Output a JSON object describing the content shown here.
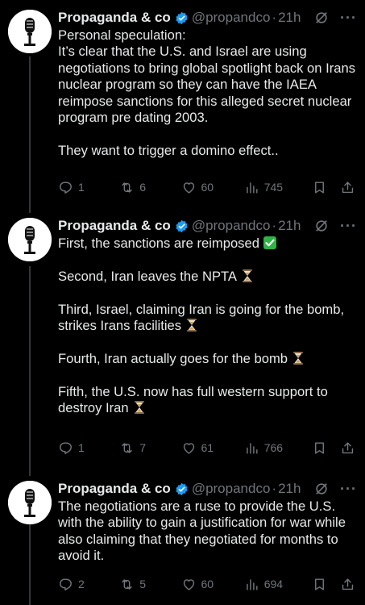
{
  "colors": {
    "background": "#000000",
    "text": "#e7e9ea",
    "muted": "#71767b",
    "verified": "#1d9bf0",
    "thread_line": "#333639"
  },
  "tweets": [
    {
      "author": {
        "name": "Propaganda & co",
        "handle": "@propandco",
        "verified": true,
        "avatar": "microphone-logo"
      },
      "separator": "·",
      "time": "21h",
      "lines": [
        "Personal speculation:",
        "It’s clear that the U.S. and Israel are using negotiations to bring global spotlight back on Irans nuclear program so they can have the IAEA reimpose sanctions for this alleged secret nuclear program pre dating 2003.",
        "They want to trigger a domino effect.."
      ],
      "stats": {
        "replies": "1",
        "reposts": "6",
        "likes": "60",
        "views": "745"
      }
    },
    {
      "author": {
        "name": "Propaganda & co",
        "handle": "@propandco",
        "verified": true,
        "avatar": "microphone-logo"
      },
      "separator": "·",
      "time": "21h",
      "lines": [
        "First, the sanctions are reimposed",
        "Second, Iran leaves the NPTA",
        "Third, Israel, claiming Iran is going for the bomb, strikes Irans facilities",
        "Fourth, Iran actually goes for the bomb",
        "Fifth, the U.S. now has full western support to destroy Iran"
      ],
      "line_emojis": [
        "check-mark-emoji",
        "hourglass-emoji",
        "hourglass-emoji",
        "hourglass-emoji",
        "hourglass-emoji"
      ],
      "stats": {
        "replies": "1",
        "reposts": "7",
        "likes": "61",
        "views": "766"
      }
    },
    {
      "author": {
        "name": "Propaganda & co",
        "handle": "@propandco",
        "verified": true,
        "avatar": "microphone-logo"
      },
      "separator": "·",
      "time": "21h",
      "lines": [
        "The negotiations are a ruse to provide the U.S. with the ability to gain a justification for war while also claiming that they negotiated for months to avoid it."
      ],
      "stats": {
        "replies": "2",
        "reposts": "5",
        "likes": "60",
        "views": "694"
      }
    }
  ]
}
